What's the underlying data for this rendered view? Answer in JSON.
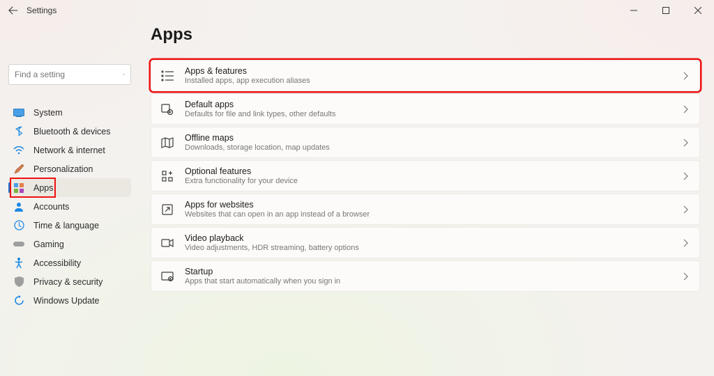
{
  "window": {
    "title": "Settings"
  },
  "search": {
    "placeholder": "Find a setting"
  },
  "sidebar": {
    "items": [
      {
        "label": "System"
      },
      {
        "label": "Bluetooth & devices"
      },
      {
        "label": "Network & internet"
      },
      {
        "label": "Personalization"
      },
      {
        "label": "Apps"
      },
      {
        "label": "Accounts"
      },
      {
        "label": "Time & language"
      },
      {
        "label": "Gaming"
      },
      {
        "label": "Accessibility"
      },
      {
        "label": "Privacy & security"
      },
      {
        "label": "Windows Update"
      }
    ]
  },
  "page": {
    "title": "Apps"
  },
  "cards": [
    {
      "title": "Apps & features",
      "sub": "Installed apps, app execution aliases"
    },
    {
      "title": "Default apps",
      "sub": "Defaults for file and link types, other defaults"
    },
    {
      "title": "Offline maps",
      "sub": "Downloads, storage location, map updates"
    },
    {
      "title": "Optional features",
      "sub": "Extra functionality for your device"
    },
    {
      "title": "Apps for websites",
      "sub": "Websites that can open in an app instead of a browser"
    },
    {
      "title": "Video playback",
      "sub": "Video adjustments, HDR streaming, battery options"
    },
    {
      "title": "Startup",
      "sub": "Apps that start automatically when you sign in"
    }
  ]
}
